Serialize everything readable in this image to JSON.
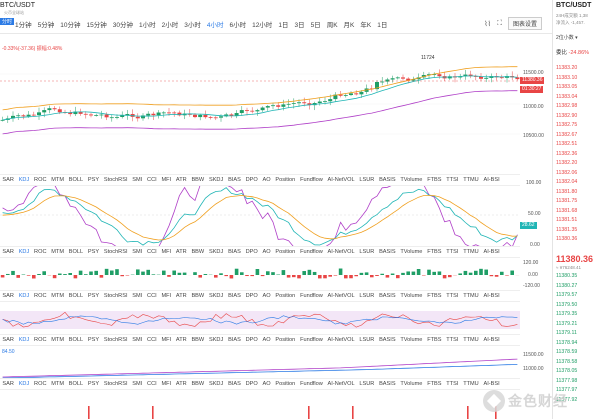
{
  "header": {
    "pair": "BTC/USDT",
    "pair_sub": "火币全球站",
    "tag": "分时",
    "intervals": [
      "1分钟",
      "5分钟",
      "10分钟",
      "15分钟",
      "30分钟",
      "1小时",
      "2小时",
      "3小时",
      "4小时",
      "6小时",
      "12小时",
      "1日",
      "3日",
      "5日",
      "周K",
      "月K",
      "年K",
      "1日"
    ],
    "active_interval": "4小时",
    "prefs_label": "图表设置",
    "icons": [
      "indicator-icon",
      "fullscreen-icon",
      "settings-icon"
    ]
  },
  "main_legend": {
    "change": "-0.33%(-37.36)",
    "amplitude": "振幅:0.48%",
    "hi_label": "11724",
    "last_tag": "11380.36",
    "countdown_tag": "01:30:27",
    "price_axis": [
      "11500.00",
      "11000.00",
      "10500.00"
    ]
  },
  "kdj_axis": [
    "100.00",
    "50.00",
    "0.00"
  ],
  "kdj_value_tag": "28.62",
  "vol_axis": [
    "120.00",
    "0.00",
    "-120.00"
  ],
  "mid_axis": [
    "11500.00",
    "11000.00"
  ],
  "mid_legend": "84.50",
  "indicators": [
    "SAR",
    "KDJ",
    "ROC",
    "MTM",
    "BOLL",
    "PSY",
    "StochRSI",
    "SMI",
    "CCI",
    "MFI",
    "ATR",
    "BBW",
    "SKDJ",
    "BIAS",
    "DPO",
    "AO",
    "Position",
    "Fundflow",
    "AI-NetVOL",
    "LSUR",
    "BASIS",
    "TVolume",
    "FTBS",
    "TTSI",
    "TTMU",
    "AI-BSI"
  ],
  "active_indicator": "KDJ",
  "right_panel": {
    "pair": "BTC/USDT",
    "line1": "24H成交额 1,38",
    "line2": "净流入 -1,457.",
    "hours": "2位小数 ▾",
    "sell_label": "委比",
    "sell_value": "-24.86%",
    "asks": [
      "11383.20",
      "11383.10",
      "11383.05",
      "11383.04",
      "11382.98",
      "11382.90",
      "11382.75",
      "11382.67",
      "11382.51",
      "11382.36",
      "11382.20",
      "11382.06",
      "11382.04",
      "11381.80",
      "11381.75",
      "11381.68",
      "11381.51",
      "11381.35",
      "11380.36"
    ],
    "last_price": "11380.36",
    "last_cny": "≈ ¥76248.41",
    "bids": [
      "11380.35",
      "11380.27",
      "11379.57",
      "11379.50",
      "11379.35",
      "11379.21",
      "11379.11",
      "11378.94",
      "11378.59",
      "11378.58",
      "11378.05",
      "11377.98",
      "11377.97",
      "11377.92"
    ]
  },
  "watermark": "金色财经",
  "colors": {
    "up": "#1f9e66",
    "down": "#e84545",
    "ma_orange": "#f0a020",
    "ma_teal": "#20b5b5",
    "ma_purple": "#b040c8",
    "accent": "#2c7be5"
  }
}
